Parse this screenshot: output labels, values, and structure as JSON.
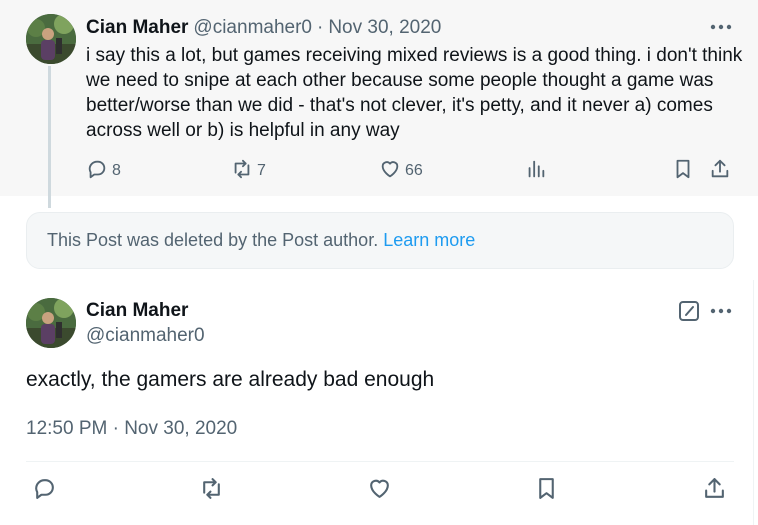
{
  "first_tweet": {
    "author_name": "Cian Maher",
    "handle": "@cianmaher0",
    "separator": "·",
    "date": "Nov 30, 2020",
    "text": "i say this a lot, but games receiving mixed reviews is a good thing. i don't think we need to snipe at each other because some people thought a game was better/worse than we did - that's not clever, it's petty, and it never a) comes across well or b) is helpful in any way",
    "replies": "8",
    "reposts": "7",
    "likes": "66"
  },
  "deleted_notice": {
    "text": "This Post was deleted by the Post author.",
    "link": "Learn more"
  },
  "main_tweet": {
    "author_name": "Cian Maher",
    "handle": "@cianmaher0",
    "text": "exactly, the gamers are already bad enough",
    "timestamp": "12:50 PM · Nov 30, 2020"
  },
  "icons": [
    "avatar",
    "more-icon",
    "reply-icon",
    "repost-icon",
    "like-icon",
    "views-icon",
    "bookmark-icon",
    "share-icon",
    "edit-icon"
  ],
  "colors": {
    "text": "#0f1419",
    "muted": "#536471",
    "link": "#1d9bf0",
    "thread_line": "#cfd9de",
    "highlight_bg": "#f7f7f7"
  }
}
